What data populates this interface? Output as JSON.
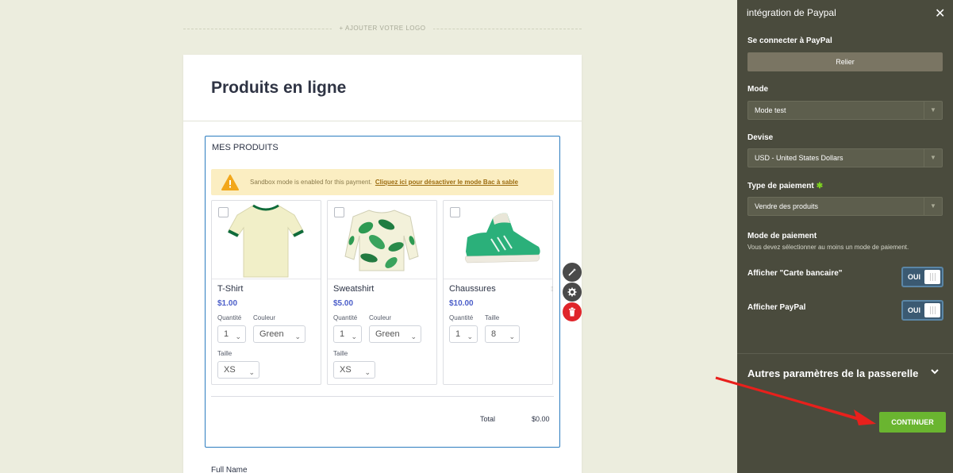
{
  "logo": {
    "add_label": "+ AJOUTER VOTRE LOGO"
  },
  "form": {
    "title": "Produits en ligne",
    "field_label": "MES PRODUITS",
    "sandbox": {
      "message": "Sandbox mode is enabled for this payment.",
      "link": "Cliquez ici pour désactiver le mode Bac à sable"
    },
    "products": [
      {
        "name": "T-Shirt",
        "price": "$1.00",
        "qty_label": "Quantité",
        "qty": "1",
        "opt_label": "Couleur",
        "opt_value": "Green",
        "size_label": "Taille",
        "size": "XS"
      },
      {
        "name": "Sweatshirt",
        "price": "$5.00",
        "qty_label": "Quantité",
        "qty": "1",
        "opt_label": "Couleur",
        "opt_value": "Green",
        "size_label": "Taille",
        "size": "XS"
      },
      {
        "name": "Chaussures",
        "price": "$10.00",
        "qty_label": "Quantité",
        "qty": "1",
        "opt_label": "Taille",
        "opt_value": "8"
      }
    ],
    "total_label": "Total",
    "total_value": "$0.00",
    "next_field_label": "Full Name"
  },
  "panel": {
    "title": "intégration de Paypal",
    "connect_label": "Se connecter à PayPal",
    "connect_button": "Relier",
    "mode_label": "Mode",
    "mode_value": "Mode test",
    "currency_label": "Devise",
    "currency_value": "USD - United States Dollars",
    "payment_type_label": "Type de paiement",
    "payment_type_required": "✱",
    "payment_type_value": "Vendre des produits",
    "payment_mode_label": "Mode de paiement",
    "payment_mode_help": "Vous devez sélectionner au moins un mode de paiement.",
    "show_card_label": "Afficher \"Carte bancaire\"",
    "show_card_toggle": "OUI",
    "show_paypal_label": "Afficher PayPal",
    "show_paypal_toggle": "OUI",
    "advanced_label": "Autres paramètres de la passerelle",
    "continue_button": "CONTINUER"
  },
  "colors": {
    "accent_blue": "#2c7cbf",
    "panel_bg": "#4a4b3d",
    "continue_green": "#6ab530",
    "annotation_red": "#e8201c"
  }
}
